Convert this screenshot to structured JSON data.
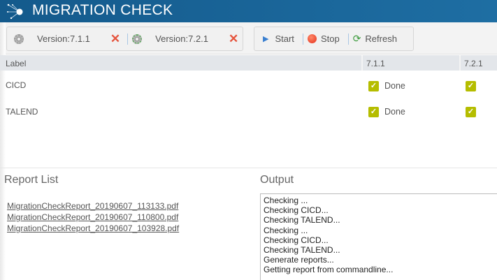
{
  "header": {
    "title": "MIGRATION CHECK"
  },
  "toolbar": {
    "versions": [
      {
        "label": "Version:7.1.1"
      },
      {
        "label": "Version:7.2.1"
      }
    ],
    "start": "Start",
    "stop": "Stop",
    "refresh": "Refresh"
  },
  "table": {
    "columns": [
      "Label",
      "7.1.1",
      "7.2.1"
    ],
    "rows": [
      {
        "label": "CICD",
        "status_711": "Done",
        "checked_711": true,
        "checked_721": true
      },
      {
        "label": "TALEND",
        "status_711": "Done",
        "checked_711": true,
        "checked_721": true
      }
    ]
  },
  "reports": {
    "title": "Report List",
    "items": [
      "MigrationCheckReport_20190607_113133.pdf",
      "MigrationCheckReport_20190607_110800.pdf",
      "MigrationCheckReport_20190607_103928.pdf"
    ]
  },
  "output": {
    "title": "Output",
    "lines": [
      "Checking ...",
      "Checking CICD...",
      "Checking TALEND...",
      "Checking ...",
      "Checking CICD...",
      "Checking TALEND...",
      "Generate reports...",
      "Getting report from commandline..."
    ]
  }
}
